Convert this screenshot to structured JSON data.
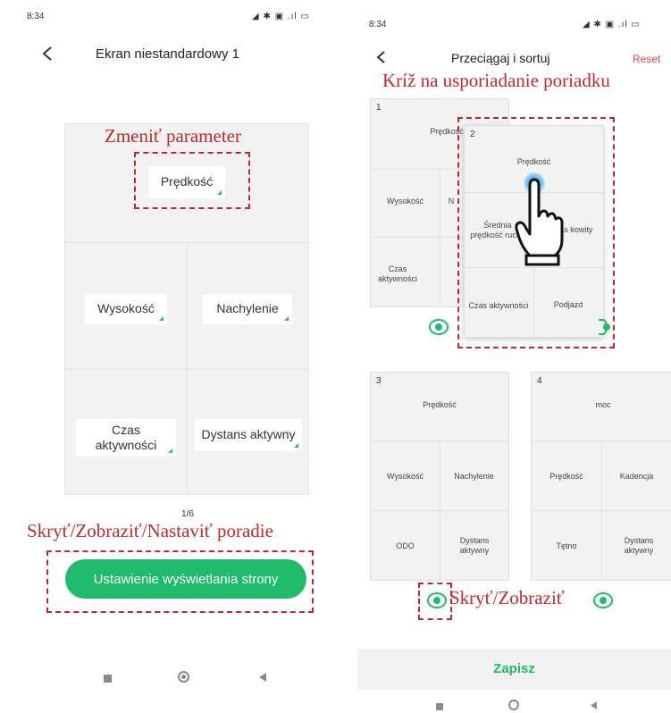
{
  "left": {
    "status": {
      "time": "8:34",
      "icons": "◢ ✱ ▣ .ıl ▭"
    },
    "header": {
      "title": "Ekran niestandardowy 1"
    },
    "cells": {
      "top": "Prędkość",
      "mid_left": "Wysokość",
      "mid_right": "Nachylenie",
      "bot_left": "Czas aktywności",
      "bot_right": "Dystans aktywny"
    },
    "annotations": {
      "change_param": "Zmeniť parameter",
      "hide_show": "Skryť/Zobraziť/Nastaviť poradie"
    },
    "page_indicator": "1/6",
    "button": {
      "label": "Ustawienie wyświetlania strony"
    }
  },
  "right": {
    "status": {
      "time": "8:34",
      "icons": "◢ ✱ ▣ .ıl ▭"
    },
    "header": {
      "title": "Przeciągaj i sortuj",
      "reset": "Reset"
    },
    "annotations": {
      "drag": "Kríž na usporiadanie poriadku",
      "hide_show": "Skryť/Zobraziť"
    },
    "card1": {
      "num": "1",
      "c1": "Prędkość",
      "c2": "Wysokość",
      "c3": "N",
      "c4": "Czas aktywności"
    },
    "card2": {
      "num": "2",
      "c1": "Prędkość",
      "c2": "Średnia prędkość ruchu",
      "c3": "zas kowity",
      "c4": "Czas aktywności",
      "c5": "Podjazd"
    },
    "card3": {
      "num": "3",
      "c1": "Prędkość",
      "c2": "Wysokość",
      "c3": "Nachylenie",
      "c4": "ODO",
      "c5": "Dystans aktywny"
    },
    "card4": {
      "num": "4",
      "c1": "moc",
      "c2": "Prędkość",
      "c3": "Kadencja",
      "c4": "Tętno",
      "c5": "Dystans aktywny"
    },
    "save": "Zapisz"
  },
  "colors": {
    "accent": "#1fba6a",
    "annotation": "#c0282d"
  }
}
